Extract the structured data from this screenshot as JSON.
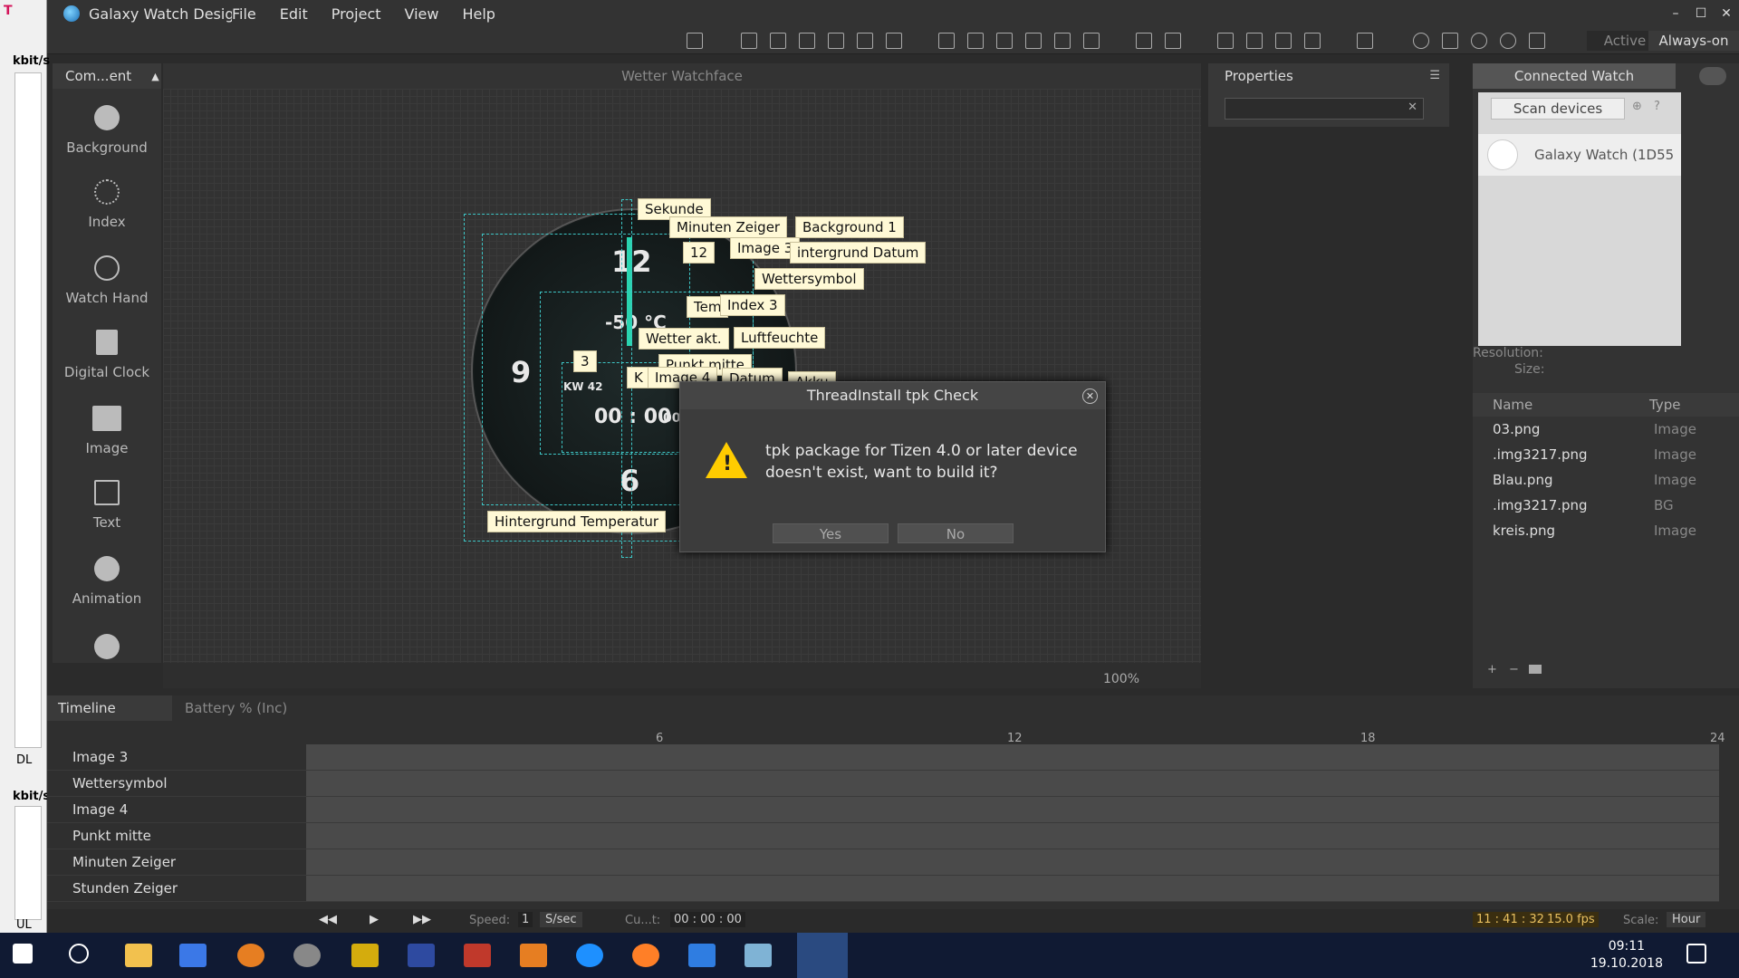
{
  "app": {
    "title": "Galaxy Watch Designer",
    "menu": [
      "File",
      "Edit",
      "Project",
      "View",
      "Help"
    ],
    "window_controls": [
      "–",
      "☐",
      "✕"
    ]
  },
  "netmeter": {
    "label_dl": "kbit/s",
    "label_dl_tag": "DL",
    "label_ul": "kbit/s",
    "label_ul_tag": "UL"
  },
  "toolbar": {
    "mode_active": "Active",
    "mode_aod": "Always-on"
  },
  "components": {
    "header": "Com...ent",
    "items": [
      "Background",
      "Index",
      "Watch Hand",
      "Digital Clock",
      "Image",
      "Text",
      "Animation"
    ]
  },
  "canvas": {
    "title": "Wetter Watchface",
    "zoom": "100%",
    "watch_numbers": {
      "twelve": "12",
      "nine": "9",
      "six": "6",
      "temp": "-50 °C",
      "kw": "KW 42",
      "digital_time": "00 : 00",
      "seconds": "00"
    },
    "tags": {
      "sekunde": "Sekunde",
      "minuten": "Minuten Zeiger",
      "background1": "Background 1",
      "twelve": "12",
      "image3": "Image 3",
      "hintergrund_datum": "intergrund Datum",
      "wettersymbol": "Wettersymbol",
      "index3": "Index 3",
      "tem": "Tem",
      "wetter_akt": "Wetter akt.",
      "luftfeuchte": "Luftfeuchte",
      "three": "3",
      "punkt": "Punkt mitte",
      "image4": "Image 4",
      "datum": "Datum",
      "akku": "Akku",
      "k": "K",
      "hintergrund_temp": "Hintergrund Temperatur"
    }
  },
  "dialog": {
    "title": "ThreadInstall tpk Check",
    "message": "tpk package for Tizen 4.0 or later device doesn't exist, want to build it?",
    "yes": "Yes",
    "no": "No",
    "close": "✕"
  },
  "properties": {
    "title": "Properties"
  },
  "connected_watch": {
    "title": "Connected Watch",
    "scan": "Scan devices",
    "device": "Galaxy Watch (1D55",
    "resolution_label": "Resolution:",
    "size_label": "Size:"
  },
  "resources": {
    "col_name": "Name",
    "col_type": "Type",
    "rows": [
      {
        "name": "03.png",
        "type": "Image"
      },
      {
        "name": ".img3217.png",
        "type": "Image"
      },
      {
        "name": "Blau.png",
        "type": "Image"
      },
      {
        "name": ".img3217.png",
        "type": "BG"
      },
      {
        "name": "kreis.png",
        "type": "Image"
      }
    ]
  },
  "timeline": {
    "tab1": "Timeline",
    "tab2": "Battery % (Inc)",
    "ticks": [
      "6",
      "12",
      "18",
      "24"
    ],
    "layers": [
      "Image 3",
      "Wettersymbol",
      "Image 4",
      "Punkt mitte",
      "Minuten Zeiger",
      "Stunden Zeiger"
    ],
    "speed_label": "Speed:",
    "speed_value": "1",
    "speed_unit": "S/sec",
    "current_label": "Cu...t:",
    "current_value": "00 : 00 : 00",
    "time": "11 : 41 : 32",
    "fps": "15.0 fps",
    "scale_label": "Scale:",
    "scale_value": "Hour"
  },
  "taskbar": {
    "time": "09:11",
    "date": "19.10.2018"
  },
  "colors": {
    "accent_dashed": "#3ec7c7",
    "tag_bg": "#fff9d6",
    "warning": "#ffcc00",
    "taskbar": "#101a33"
  }
}
